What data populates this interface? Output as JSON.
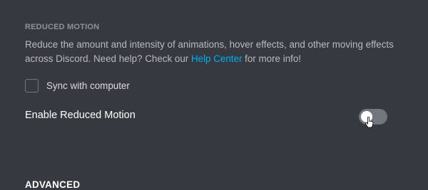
{
  "reduced_motion": {
    "section_title": "REDUCED MOTION",
    "description_before_link": "Reduce the amount and intensity of animations, hover effects, and other moving effects across Discord. Need help? Check our ",
    "help_link": "Help Center",
    "description_after_link": " for more info!",
    "sync_label": "Sync with computer",
    "sync_checked": false,
    "enable_label": "Enable Reduced Motion",
    "enable_on": false
  },
  "advanced": {
    "section_title": "ADVANCED"
  },
  "colors": {
    "background": "#36393f",
    "link": "#00aff4",
    "toggle_off": "#72767d"
  },
  "icons": {
    "cursor": "hand-pointer-icon"
  }
}
